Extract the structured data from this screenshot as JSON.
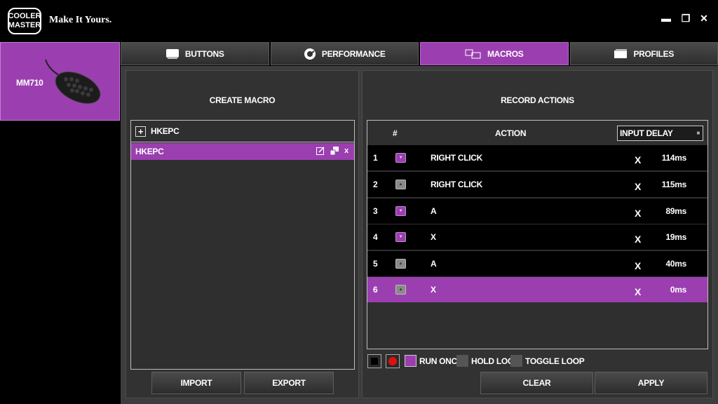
{
  "brand": {
    "logo_line1": "COOLER",
    "logo_line2": "MASTER",
    "tagline": "Make It Yours."
  },
  "window": {
    "minimize": "▬",
    "maximize": "❐",
    "close": "✕"
  },
  "device": {
    "name": "MM710"
  },
  "tabs": [
    {
      "label": "BUTTONS",
      "icon": "keyboard-icon"
    },
    {
      "label": "PERFORMANCE",
      "icon": "gauge-icon"
    },
    {
      "label": "MACROS",
      "icon": "macro-icon"
    },
    {
      "label": "PROFILES",
      "icon": "folder-icon"
    }
  ],
  "create_macro": {
    "title": "CREATE MACRO",
    "header_name": "HKEPC",
    "item_name": "HKEPC",
    "import_label": "IMPORT",
    "export_label": "EXPORT"
  },
  "record": {
    "title": "RECORD ACTIONS",
    "col_num": "#",
    "col_action": "ACTION",
    "delay_select": "INPUT DELAY",
    "rows": [
      {
        "num": "1",
        "type": "down",
        "action": "RIGHT CLICK",
        "x": "X",
        "delay": "114ms"
      },
      {
        "num": "2",
        "type": "up",
        "action": "RIGHT CLICK",
        "x": "X",
        "delay": "115ms"
      },
      {
        "num": "3",
        "type": "down",
        "action": "A",
        "x": "X",
        "delay": "89ms"
      },
      {
        "num": "4",
        "type": "down",
        "action": "X",
        "x": "X",
        "delay": "19ms"
      },
      {
        "num": "5",
        "type": "up",
        "action": "A",
        "x": "X",
        "delay": "40ms"
      },
      {
        "num": "6",
        "type": "up",
        "action": "X",
        "x": "X",
        "delay": "0ms"
      }
    ],
    "selected_row": 6,
    "run_once": "RUN ONCE",
    "hold_loop": "HOLD LOOP",
    "toggle_loop": "TOGGLE LOOP",
    "clear_label": "CLEAR",
    "apply_label": "APPLY"
  },
  "colors": {
    "accent": "#9b3fb0",
    "record": "#e01010"
  }
}
